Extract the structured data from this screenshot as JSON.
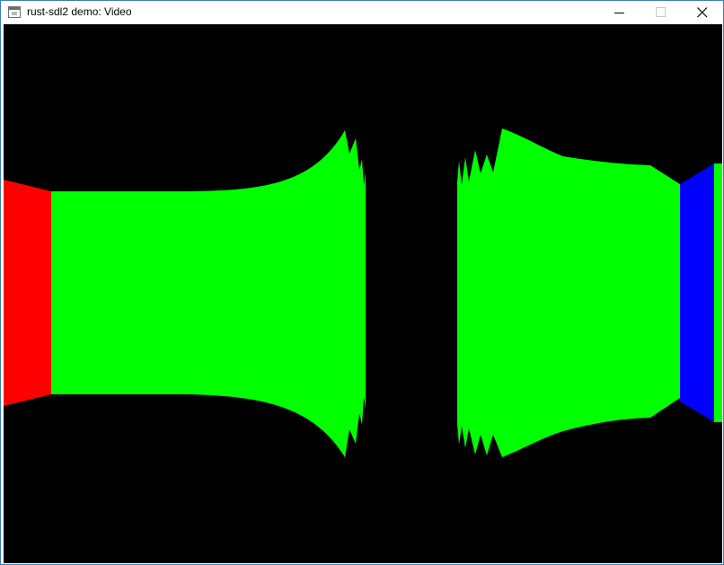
{
  "window": {
    "title": "rust-sdl2 demo: Video",
    "buttons": {
      "minimize_icon": "minimize-icon",
      "maximize_icon": "maximize-icon",
      "close_icon": "close-icon"
    }
  },
  "canvas": {
    "background": "#000000",
    "colors": {
      "red": "#ff0000",
      "green": "#00ff00",
      "blue": "#0000ff"
    }
  }
}
